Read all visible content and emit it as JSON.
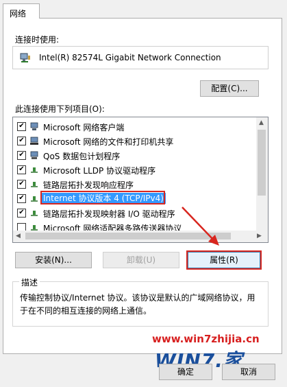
{
  "tab": {
    "label": "网络"
  },
  "connect_label": "连接时使用:",
  "adapter_name": "Intel(R) 82574L Gigabit Network Connection",
  "configure_button": "配置(C)...",
  "items_label": "此连接使用下列项目(O):",
  "items": [
    {
      "label": "Microsoft 网络客户端",
      "checked": true,
      "icon": "network-client-icon"
    },
    {
      "label": "Microsoft 网络的文件和打印机共享",
      "checked": true,
      "icon": "file-share-icon"
    },
    {
      "label": "QoS 数据包计划程序",
      "checked": true,
      "icon": "qos-icon"
    },
    {
      "label": "Microsoft LLDP 协议驱动程序",
      "checked": true,
      "icon": "protocol-icon"
    },
    {
      "label": "链路层拓扑发现响应程序",
      "checked": true,
      "icon": "protocol-icon"
    },
    {
      "label": "Internet 协议版本 4 (TCP/IPv4)",
      "checked": true,
      "icon": "protocol-icon",
      "selected": true
    },
    {
      "label": "链路层拓扑发现映射器 I/O 驱动程序",
      "checked": true,
      "icon": "protocol-icon"
    },
    {
      "label": "Microsoft 网络适配器多路传送器协议",
      "checked": false,
      "icon": "protocol-icon"
    }
  ],
  "buttons": {
    "install": "安装(N)...",
    "uninstall": "卸载(U)",
    "properties": "属性(R)"
  },
  "description": {
    "title": "描述",
    "text": "传输控制协议/Internet 协议。该协议是默认的广域网络协议，用于在不同的相互连接的网络上通信。"
  },
  "watermark": {
    "url": "www.win7zhijia.cn",
    "logo": "WIN7.家"
  },
  "footer": {
    "ok": "确定",
    "cancel": "取消"
  },
  "colors": {
    "highlight": "#d8261f",
    "selection": "#3399ff",
    "accent": "#3c7fb1"
  }
}
